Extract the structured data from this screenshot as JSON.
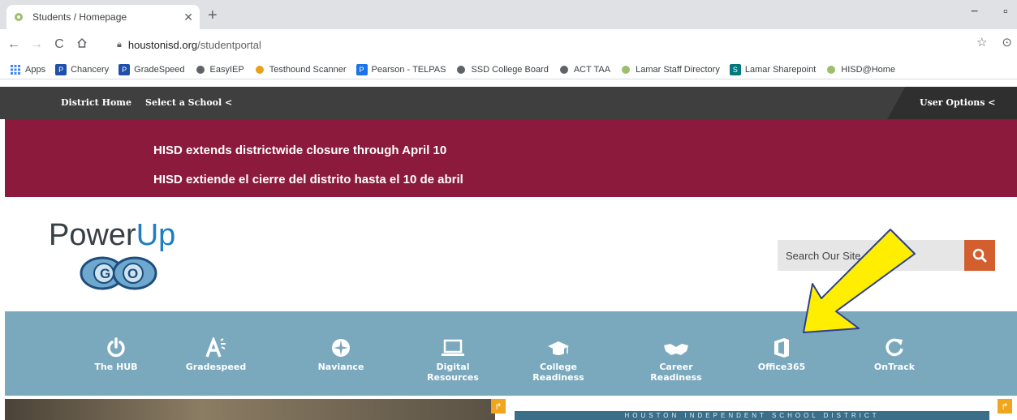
{
  "browser": {
    "tab_title": "Students / Homepage",
    "new_tab": "+",
    "url_host": "houstonisd.org",
    "url_path": "/studentportal",
    "minimize": "−",
    "restore": "▫"
  },
  "bookmarks": [
    {
      "label": "Apps",
      "icon": "apps-grid-icon",
      "color": "#4285f4"
    },
    {
      "label": "Chancery",
      "icon": "P",
      "color": "#1f4fa8"
    },
    {
      "label": "GradeSpeed",
      "icon": "P",
      "color": "#1f4fa8"
    },
    {
      "label": "EasyIEP",
      "icon": "globe-icon",
      "color": "#5f6368"
    },
    {
      "label": "Testhound Scanner",
      "icon": "testhound-icon",
      "color": "#e8a21a"
    },
    {
      "label": "Pearson - TELPAS",
      "icon": "P",
      "color": "#1a73e8"
    },
    {
      "label": "SSD College Board",
      "icon": "shield-icon",
      "color": "#5f6368"
    },
    {
      "label": "ACT TAA",
      "icon": "globe-icon",
      "color": "#5f6368"
    },
    {
      "label": "Lamar Staff Directory",
      "icon": "hisd-icon",
      "color": "#9bbf6a"
    },
    {
      "label": "Lamar Sharepoint",
      "icon": "S",
      "color": "#03787c"
    },
    {
      "label": "HISD@Home",
      "icon": "hisd-icon",
      "color": "#9bbf6a"
    }
  ],
  "topnav": {
    "district_home": "District Home",
    "select_school": "Select a School <",
    "user_options": "User Options <"
  },
  "alert": {
    "line1": "HISD extends districtwide closure through April 10",
    "line2": "HISD extiende el cierre del distrito hasta el 10 de abril"
  },
  "logo": {
    "power": "Power",
    "up": "Up",
    "go": "GO"
  },
  "search": {
    "placeholder": "Search Our Site"
  },
  "quicklinks": [
    {
      "line1": "The HUB",
      "line2": "",
      "icon": "power-icon"
    },
    {
      "line1": "Gradespeed",
      "line2": "",
      "icon": "grade-a-icon"
    },
    {
      "line1": "Naviance",
      "line2": "",
      "icon": "compass-icon"
    },
    {
      "line1": "Digital",
      "line2": "Resources",
      "icon": "laptop-icon"
    },
    {
      "line1": "College",
      "line2": "Readiness",
      "icon": "graduation-cap-icon"
    },
    {
      "line1": "Career",
      "line2": "Readiness",
      "icon": "handshake-icon"
    },
    {
      "line1": "Office365",
      "line2": "",
      "icon": "office-icon"
    },
    {
      "line1": "OnTrack",
      "line2": "",
      "icon": "refresh-icon"
    }
  ],
  "banner": {
    "text": "HOUSTON INDEPENDENT SCHOOL DISTRICT"
  },
  "colors": {
    "alert_bg": "#8b1a3c",
    "iconbar_bg": "#7aa8bd",
    "search_button": "#d35f2e",
    "annotation_arrow": "#ffee00"
  }
}
